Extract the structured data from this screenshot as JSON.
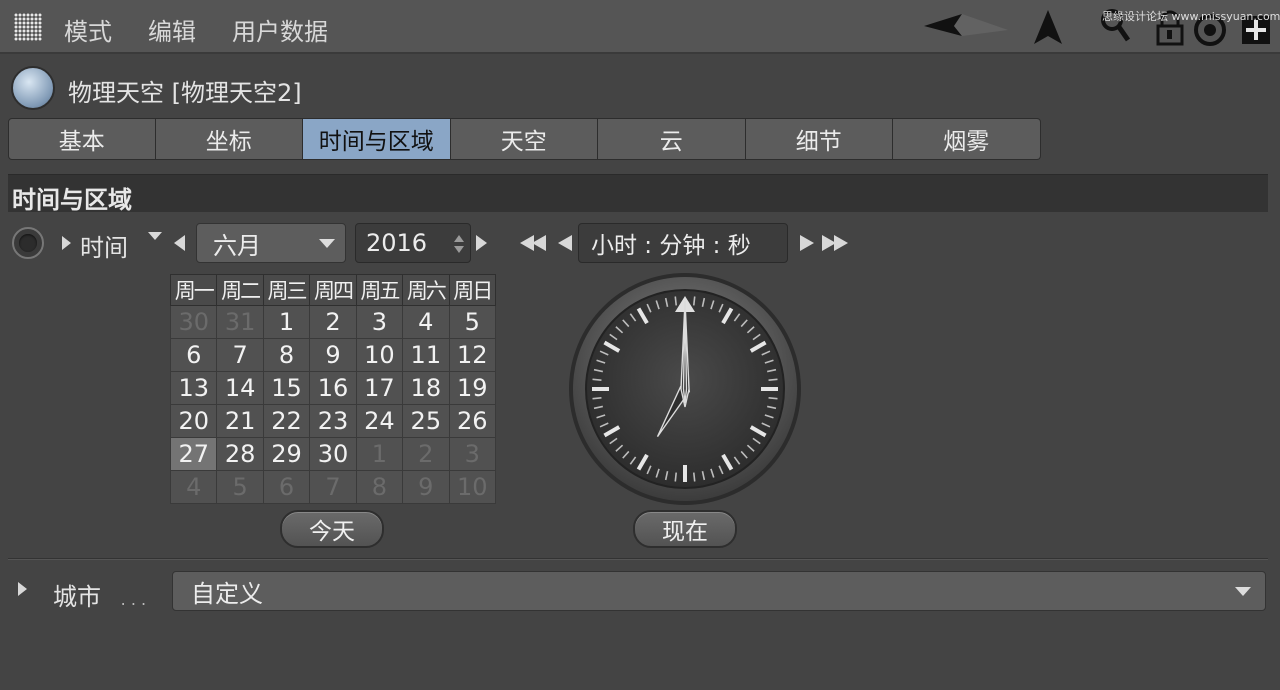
{
  "menubar": {
    "items": [
      "模式",
      "编辑",
      "用户数据"
    ],
    "watermark": "思缘设计论坛 www.missyuan.com"
  },
  "object": {
    "title": "物理天空 [物理天空2]"
  },
  "tabs": [
    {
      "label": "基本",
      "active": false
    },
    {
      "label": "坐标",
      "active": false
    },
    {
      "label": "时间与区域",
      "active": true
    },
    {
      "label": "天空",
      "active": false
    },
    {
      "label": "云",
      "active": false
    },
    {
      "label": "细节",
      "active": false
    },
    {
      "label": "烟雾",
      "active": false
    }
  ],
  "section": {
    "title": "时间与区域"
  },
  "time": {
    "label": "时间",
    "month": "六月",
    "year": "2016",
    "clock_format": "小时 : 分钟 : 秒",
    "today_button": "今天",
    "now_button": "现在",
    "clock_hour": 7,
    "clock_minute": 0,
    "clock_second": 0
  },
  "calendar": {
    "weekdays": [
      "周一",
      "周二",
      "周三",
      "周四",
      "周五",
      "周六",
      "周日"
    ],
    "weeks": [
      [
        {
          "d": "30",
          "dim": true
        },
        {
          "d": "31",
          "dim": true
        },
        {
          "d": "1"
        },
        {
          "d": "2"
        },
        {
          "d": "3"
        },
        {
          "d": "4"
        },
        {
          "d": "5"
        }
      ],
      [
        {
          "d": "6"
        },
        {
          "d": "7"
        },
        {
          "d": "8"
        },
        {
          "d": "9"
        },
        {
          "d": "10"
        },
        {
          "d": "11"
        },
        {
          "d": "12"
        }
      ],
      [
        {
          "d": "13"
        },
        {
          "d": "14"
        },
        {
          "d": "15"
        },
        {
          "d": "16"
        },
        {
          "d": "17"
        },
        {
          "d": "18"
        },
        {
          "d": "19"
        }
      ],
      [
        {
          "d": "20"
        },
        {
          "d": "21"
        },
        {
          "d": "22"
        },
        {
          "d": "23"
        },
        {
          "d": "24"
        },
        {
          "d": "25"
        },
        {
          "d": "26"
        }
      ],
      [
        {
          "d": "27",
          "selected": true
        },
        {
          "d": "28"
        },
        {
          "d": "29"
        },
        {
          "d": "30"
        },
        {
          "d": "1",
          "dim": true
        },
        {
          "d": "2",
          "dim": true
        },
        {
          "d": "3",
          "dim": true
        }
      ],
      [
        {
          "d": "4",
          "dim": true
        },
        {
          "d": "5",
          "dim": true
        },
        {
          "d": "6",
          "dim": true
        },
        {
          "d": "7",
          "dim": true
        },
        {
          "d": "8",
          "dim": true
        },
        {
          "d": "9",
          "dim": true
        },
        {
          "d": "10",
          "dim": true
        }
      ]
    ]
  },
  "city": {
    "label": "城市",
    "dots": ". . .",
    "value": "自定义"
  },
  "colors": {
    "active_tab": "#8aa6c6",
    "background": "#444444"
  }
}
